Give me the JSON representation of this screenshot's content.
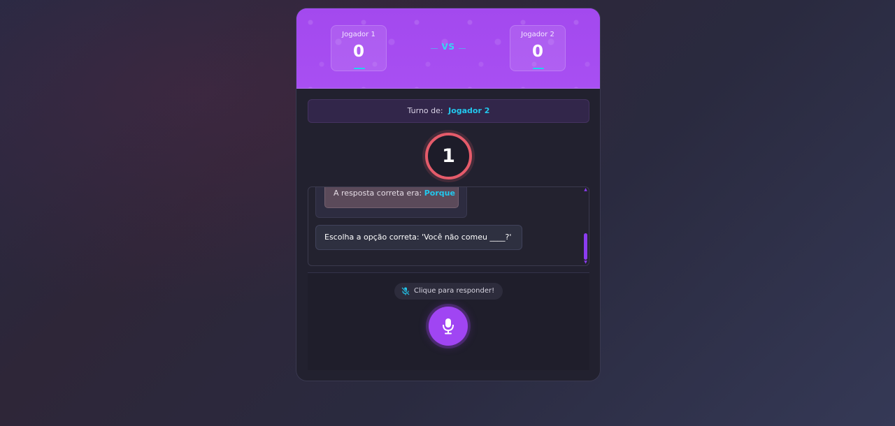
{
  "colors": {
    "header_purple": "#a847f0",
    "accent_cyan": "#22c8ee",
    "timer_red": "#e55b6a",
    "mic_purple": "#a045f3"
  },
  "scoreboard": {
    "player1": {
      "name": "Jogador 1",
      "score": "0"
    },
    "vs": "VS",
    "player2": {
      "name": "Jogador 2",
      "score": "0"
    }
  },
  "turn": {
    "label": "Turno de:",
    "player": "Jogador 2"
  },
  "timer": {
    "value": "1"
  },
  "chat": {
    "previous_message": {
      "prefix": "A resposta correta era:",
      "answer": "Porque"
    },
    "current_message": "Escolha a opção correta: 'Você não comeu ____?'"
  },
  "input": {
    "hint_icon": "microphone-slash-icon",
    "hint": "Clique para responder!",
    "mic_button_icon": "microphone-icon"
  }
}
